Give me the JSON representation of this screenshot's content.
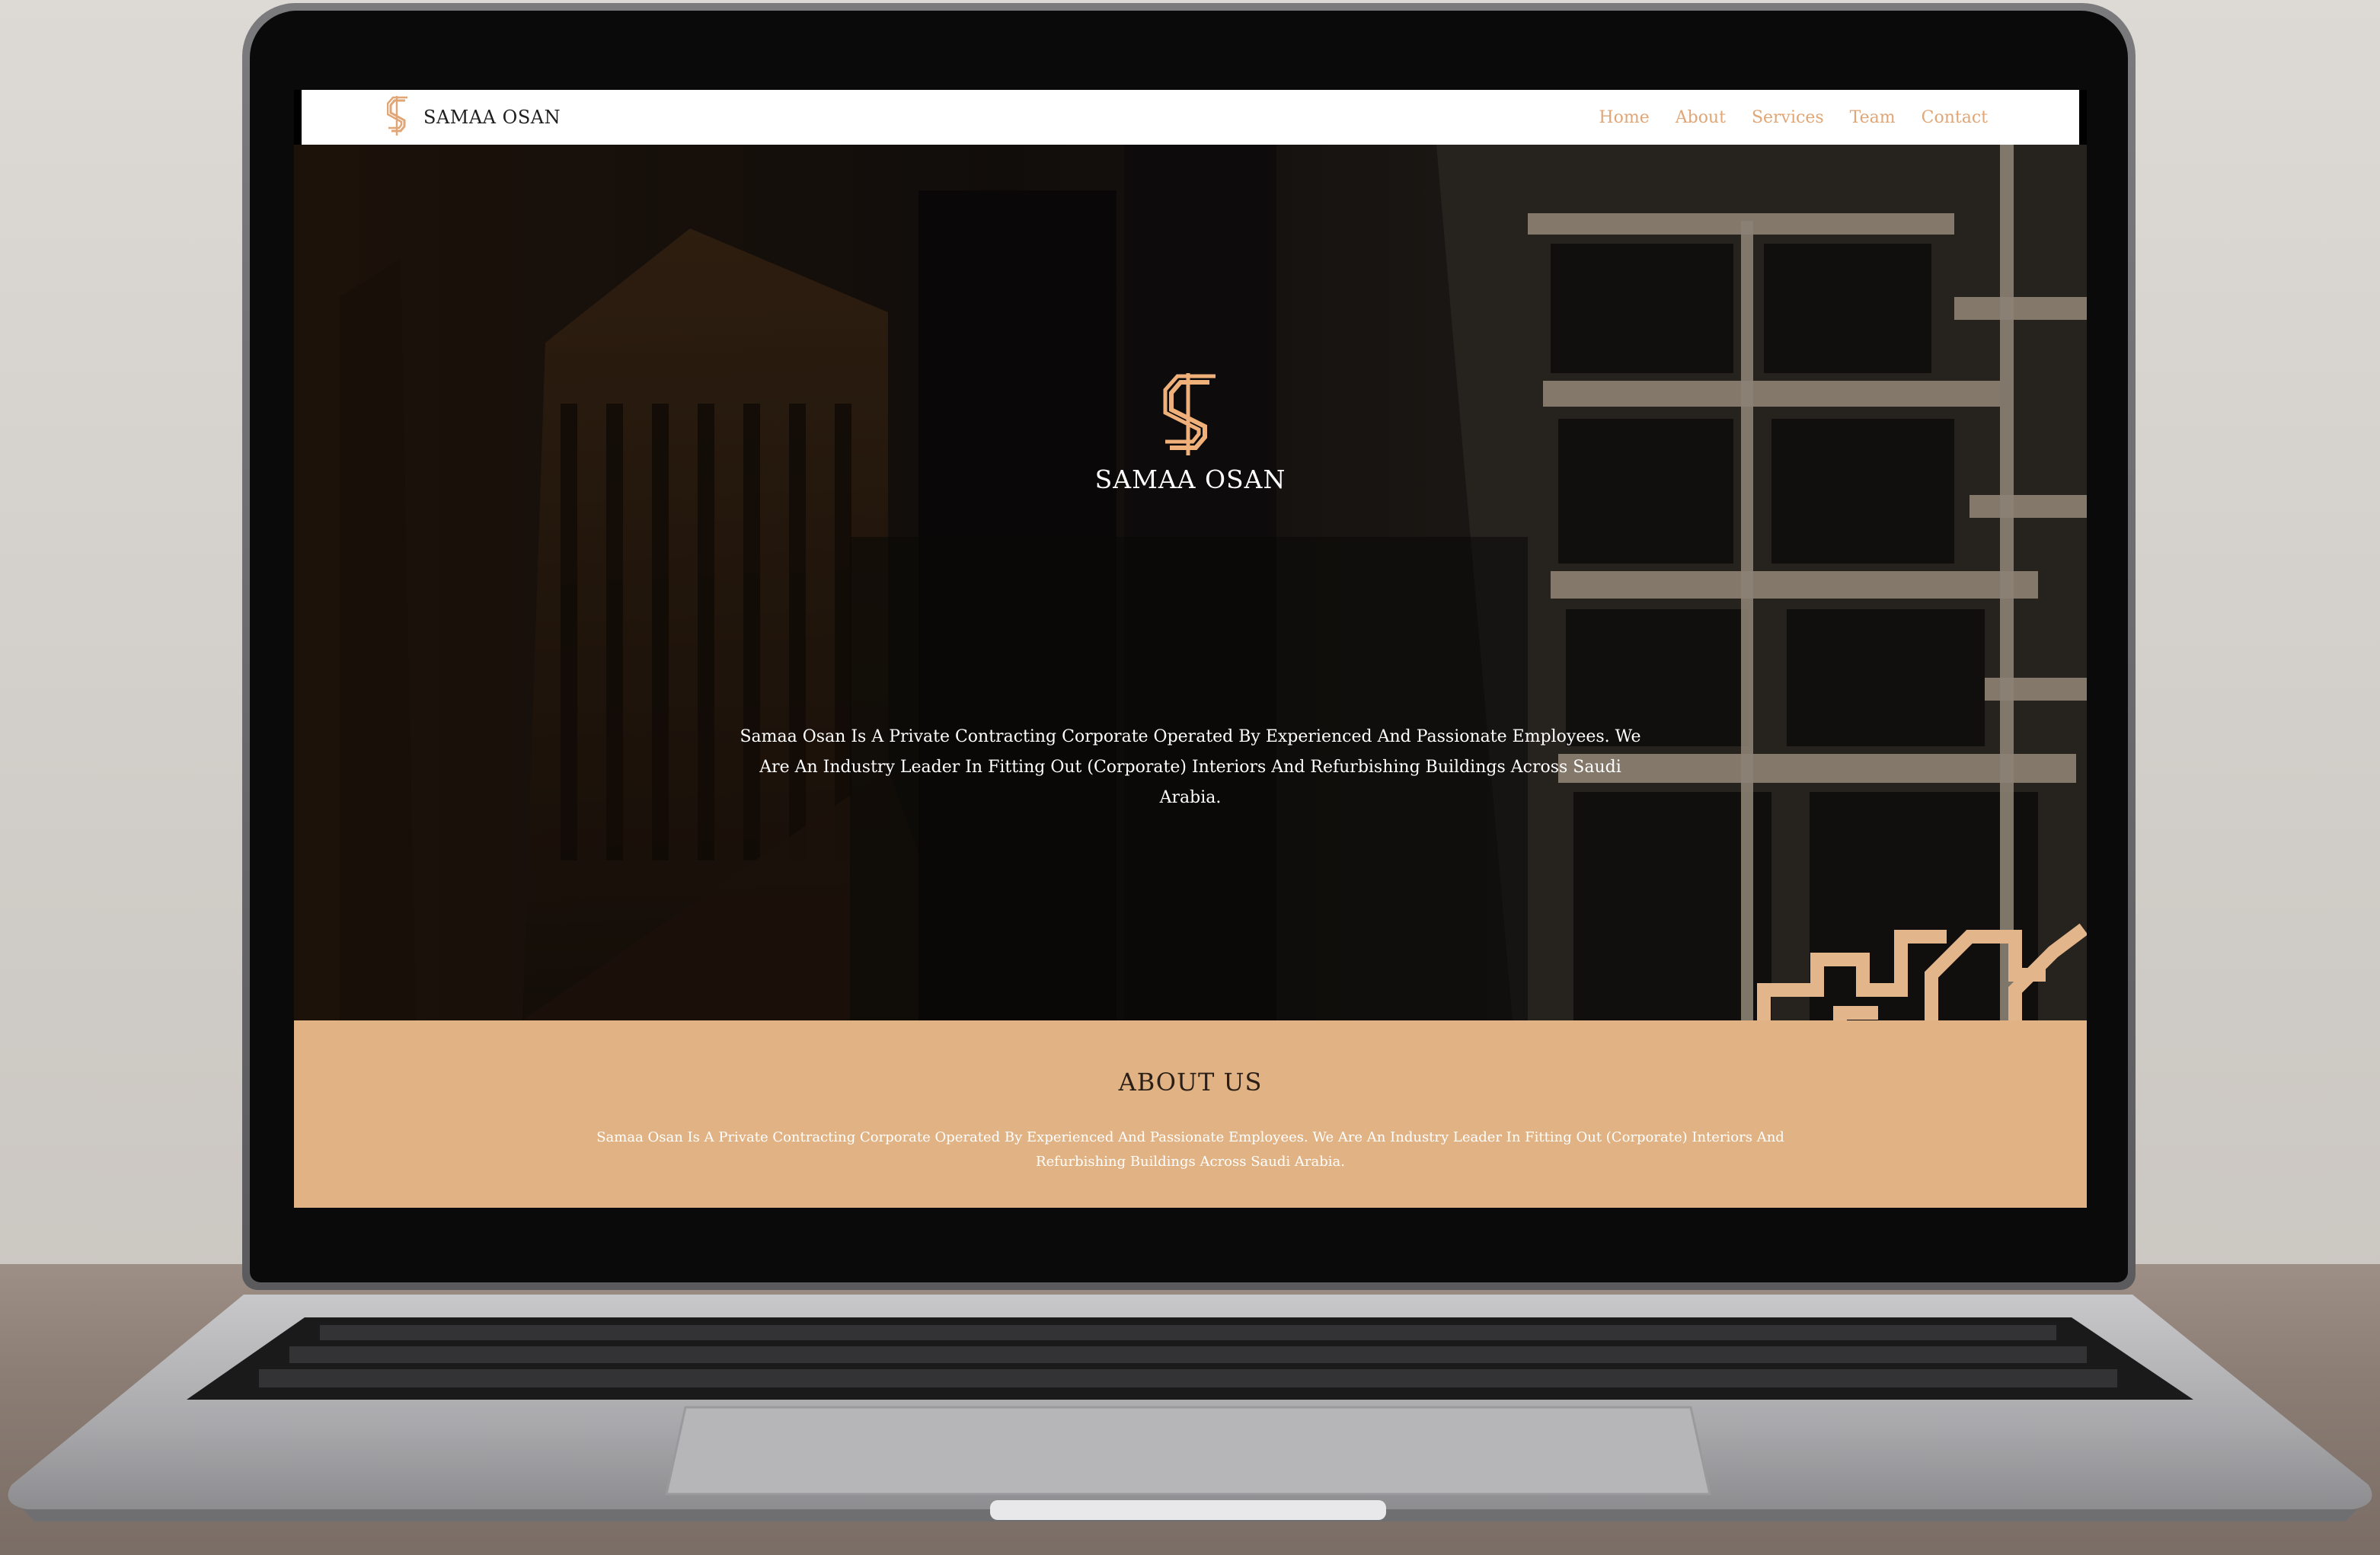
{
  "header": {
    "brand_name": "SAMAA OSAN",
    "nav": [
      "Home",
      "About",
      "Services",
      "Team",
      "Contact"
    ]
  },
  "hero": {
    "title": "SAMAA OSAN",
    "text": "Samaa Osan Is A Private Contracting Corporate Operated By Experienced And Passionate Employees. We Are An Industry Leader In Fitting Out (Corporate) Interiors And Refurbishing Buildings Across Saudi Arabia."
  },
  "about": {
    "title": "ABOUT US",
    "text": "Samaa Osan Is A Private Contracting Corporate Operated By Experienced And Passionate Employees. We Are An Industry Leader In Fitting Out (Corporate) Interiors And Refurbishing Buildings Across Saudi Arabia."
  },
  "colors": {
    "accent": "#e0a676",
    "about_bg": "#e1b384",
    "nav_bg": "#ffffff"
  },
  "icons": {
    "brand": "s-logo-icon",
    "hero": "s-logo-icon"
  }
}
